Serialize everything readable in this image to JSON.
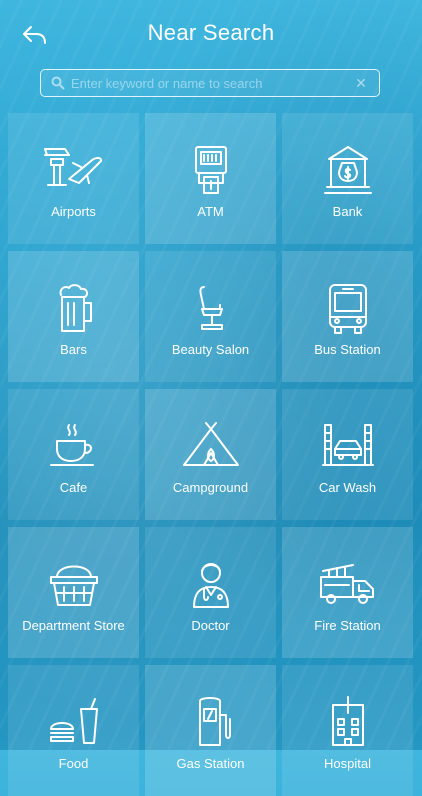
{
  "header": {
    "title": "Near Search"
  },
  "search": {
    "placeholder": "Enter keyword or name to search",
    "value": "",
    "clear_label": "✕"
  },
  "categories": [
    {
      "label": "Airports",
      "icon": "airport-icon"
    },
    {
      "label": "ATM",
      "icon": "atm-icon"
    },
    {
      "label": "Bank",
      "icon": "bank-icon"
    },
    {
      "label": "Bars",
      "icon": "beer-mug-icon"
    },
    {
      "label": "Beauty Salon",
      "icon": "salon-chair-icon"
    },
    {
      "label": "Bus Station",
      "icon": "bus-icon"
    },
    {
      "label": "Cafe",
      "icon": "coffee-cup-icon"
    },
    {
      "label": "Campground",
      "icon": "tent-icon"
    },
    {
      "label": "Car Wash",
      "icon": "car-wash-icon"
    },
    {
      "label": "Department Store",
      "icon": "shopping-basket-icon"
    },
    {
      "label": "Doctor",
      "icon": "doctor-icon"
    },
    {
      "label": "Fire Station",
      "icon": "fire-truck-icon"
    },
    {
      "label": "Food",
      "icon": "food-icon"
    },
    {
      "label": "Gas Station",
      "icon": "gas-pump-icon"
    },
    {
      "label": "Hospital",
      "icon": "hospital-icon"
    }
  ]
}
